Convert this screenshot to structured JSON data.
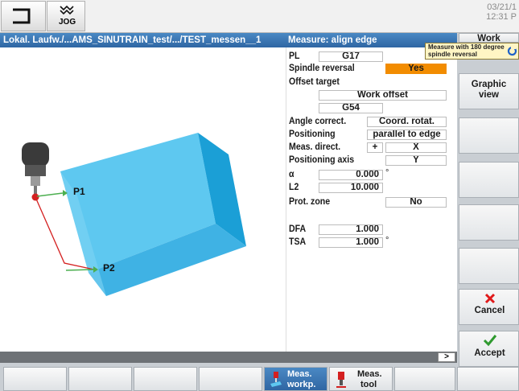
{
  "topbar": {
    "mode_label": "JOG",
    "date": "03/21/1",
    "time": "12:31 P"
  },
  "titlebar": {
    "path": "Lokal. Laufw./...AMS_SINUTRAIN_test/.../TEST_messen__1",
    "function": "Measure: align edge"
  },
  "graphic": {
    "point1": "P1",
    "point2": "P2"
  },
  "params": {
    "pl_label": "PL",
    "pl_value": "G17",
    "spindle_label": "Spindle reversal",
    "spindle_value": "Yes",
    "offset_label": "Offset target",
    "offset_value": "Work offset",
    "g54_value": "G54",
    "angle_label": "Angle correct.",
    "angle_value": "Coord. rotat.",
    "positioning_label": "Positioning",
    "positioning_value": "parallel to edge",
    "measdir_label": "Meas. direct.",
    "measdir_sign": "+",
    "measdir_value": "X",
    "posaxis_label": "Positioning axis",
    "posaxis_value": "Y",
    "alpha_label": "α",
    "alpha_value": "0.000",
    "alpha_unit": "°",
    "l2_label": "L2",
    "l2_value": "10.000",
    "prot_label": "Prot. zone",
    "prot_value": "No",
    "dfa_label": "DFA",
    "dfa_value": "1.000",
    "tsa_label": "TSA",
    "tsa_value": "1.000",
    "tsa_unit": "°"
  },
  "tooltip": {
    "line1": "Measure with 180 degree",
    "line2": "spindle reversal"
  },
  "softkeys_right": {
    "top_partial": "Work",
    "graphic_view_1": "Graphic",
    "graphic_view_2": "view",
    "cancel": "Cancel",
    "accept": "Accept"
  },
  "softkeys_bottom": {
    "meas_workp_1": "Meas.",
    "meas_workp_2": "workp.",
    "meas_tool_1": "Meas.",
    "meas_tool_2": "tool"
  },
  "scroll_indicator": ">",
  "colors": {
    "title_blue": "#3470ad",
    "highlight_orange": "#f28c00",
    "part_blue": "#5ec8f0",
    "cancel_red": "#e01a1a",
    "accept_green": "#2f9a2f",
    "path_red": "#d42020",
    "axis_green": "#4caf50"
  }
}
